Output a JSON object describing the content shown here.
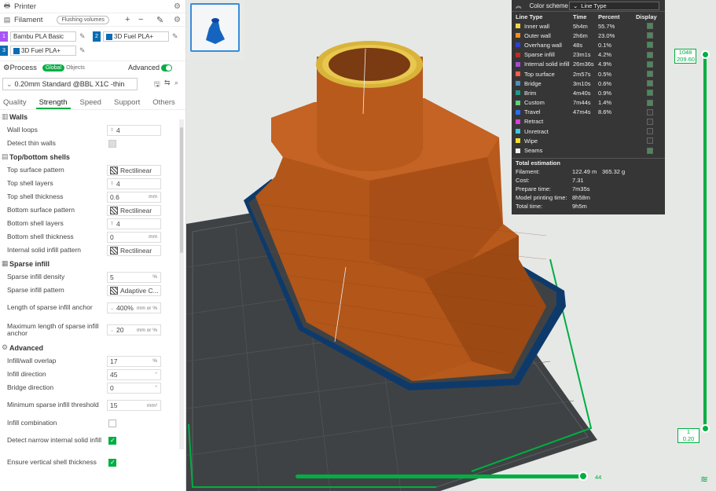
{
  "printer": {
    "label": "Printer"
  },
  "filament": {
    "label": "Filament",
    "flushing_label": "Flushing volumes",
    "items": [
      {
        "num": "1",
        "name": "Bambu PLA Basic",
        "color": "#a855f7"
      },
      {
        "num": "2",
        "name": "3D Fuel PLA+",
        "color": "#0a6db3"
      },
      {
        "num": "3",
        "name": "3D Fuel PLA+",
        "color": "#0a6db3"
      }
    ]
  },
  "process": {
    "label": "Process",
    "global_label": "Global",
    "objects_label": "Objects",
    "advanced_label": "Advanced",
    "preset": "0.20mm Standard @BBL X1C -thin"
  },
  "tabs": [
    "Quality",
    "Strength",
    "Speed",
    "Support",
    "Others"
  ],
  "sections": {
    "walls": "Walls",
    "top_bottom": "Top/bottom shells",
    "sparse": "Sparse infill",
    "advanced": "Advanced"
  },
  "fields": {
    "wall_loops": {
      "label": "Wall loops",
      "value": "4"
    },
    "detect_thin": {
      "label": "Detect thin walls"
    },
    "top_pattern": {
      "label": "Top surface pattern",
      "value": "Rectilinear"
    },
    "top_layers": {
      "label": "Top shell layers",
      "value": "4"
    },
    "top_thickness": {
      "label": "Top shell thickness",
      "value": "0.6",
      "unit": "mm"
    },
    "bottom_pattern": {
      "label": "Bottom surface pattern",
      "value": "Rectilinear"
    },
    "bottom_layers": {
      "label": "Bottom shell layers",
      "value": "4"
    },
    "bottom_thickness": {
      "label": "Bottom shell thickness",
      "value": "0",
      "unit": "mm"
    },
    "internal_pattern": {
      "label": "Internal solid infill pattern",
      "value": "Rectilinear"
    },
    "density": {
      "label": "Sparse infill density",
      "value": "5",
      "unit": "%"
    },
    "sparse_pattern": {
      "label": "Sparse infill pattern",
      "value": "Adaptive C..."
    },
    "anchor": {
      "label": "Length of sparse infill anchor",
      "value": "400%",
      "unit": "mm or %"
    },
    "anchor_max": {
      "label": "Maximum length of sparse infill anchor",
      "value": "20",
      "unit": "mm or %"
    },
    "overlap": {
      "label": "Infill/wall overlap",
      "value": "17",
      "unit": "%"
    },
    "direction": {
      "label": "Infill direction",
      "value": "45",
      "unit": "°"
    },
    "bridge_dir": {
      "label": "Bridge direction",
      "value": "0",
      "unit": "°"
    },
    "min_sparse": {
      "label": "Minimum sparse infill threshold",
      "value": "15",
      "unit": "mm²"
    },
    "infill_comb": {
      "label": "Infill combination"
    },
    "detect_narrow": {
      "label": "Detect narrow internal solid infill"
    },
    "ensure_vert": {
      "label": "Ensure vertical shell thickness"
    }
  },
  "legend": {
    "title": "Color scheme",
    "type_select": "Line Type",
    "headers": [
      "Line Type",
      "Time",
      "Percent",
      "Display"
    ],
    "rows": [
      {
        "name": "Inner wall",
        "time": "5h4m",
        "pct": "55.7%",
        "color": "#f5d547",
        "on": true
      },
      {
        "name": "Outer wall",
        "time": "2h6m",
        "pct": "23.0%",
        "color": "#ff8a1f",
        "on": true
      },
      {
        "name": "Overhang wall",
        "time": "48s",
        "pct": "0.1%",
        "color": "#2f3fd6",
        "on": true
      },
      {
        "name": "Sparse infill",
        "time": "23m1s",
        "pct": "4.2%",
        "color": "#c02a2a",
        "on": true
      },
      {
        "name": "Internal solid infill",
        "time": "26m36s",
        "pct": "4.9%",
        "color": "#a64bd6",
        "on": true
      },
      {
        "name": "Top surface",
        "time": "2m57s",
        "pct": "0.5%",
        "color": "#ff5a4a",
        "on": true
      },
      {
        "name": "Bridge",
        "time": "3m10s",
        "pct": "0.6%",
        "color": "#4a8fbf",
        "on": true
      },
      {
        "name": "Brim",
        "time": "4m40s",
        "pct": "0.9%",
        "color": "#1f9a8a",
        "on": true
      },
      {
        "name": "Custom",
        "time": "7m44s",
        "pct": "1.4%",
        "color": "#5ecf7a",
        "on": true
      },
      {
        "name": "Travel",
        "time": "47m4s",
        "pct": "8.6%",
        "color": "#2a6cf0",
        "on": false
      },
      {
        "name": "Retract",
        "time": "",
        "pct": "",
        "color": "#d63fd6",
        "on": false
      },
      {
        "name": "Unretract",
        "time": "",
        "pct": "",
        "color": "#40c8e0",
        "on": false
      },
      {
        "name": "Wipe",
        "time": "",
        "pct": "",
        "color": "#f0e02a",
        "on": false
      },
      {
        "name": "Seams",
        "time": "",
        "pct": "",
        "color": "#f2f2f2",
        "on": true
      }
    ],
    "total_title": "Total estimation",
    "totals": [
      {
        "label": "Filament:",
        "v1": "122.49 m",
        "v2": "365.32 g"
      },
      {
        "label": "Cost:",
        "v1": "7.31",
        "v2": ""
      },
      {
        "label": "Prepare time:",
        "v1": "7m35s",
        "v2": ""
      },
      {
        "label": "Model printing time:",
        "v1": "8h58m",
        "v2": ""
      },
      {
        "label": "Total time:",
        "v1": "9h5m",
        "v2": ""
      }
    ]
  },
  "slider": {
    "top_layer": "1048",
    "top_height": "209.60",
    "bottom_layer": "1",
    "bottom_height": "0.20",
    "horizontal_value": "44"
  }
}
